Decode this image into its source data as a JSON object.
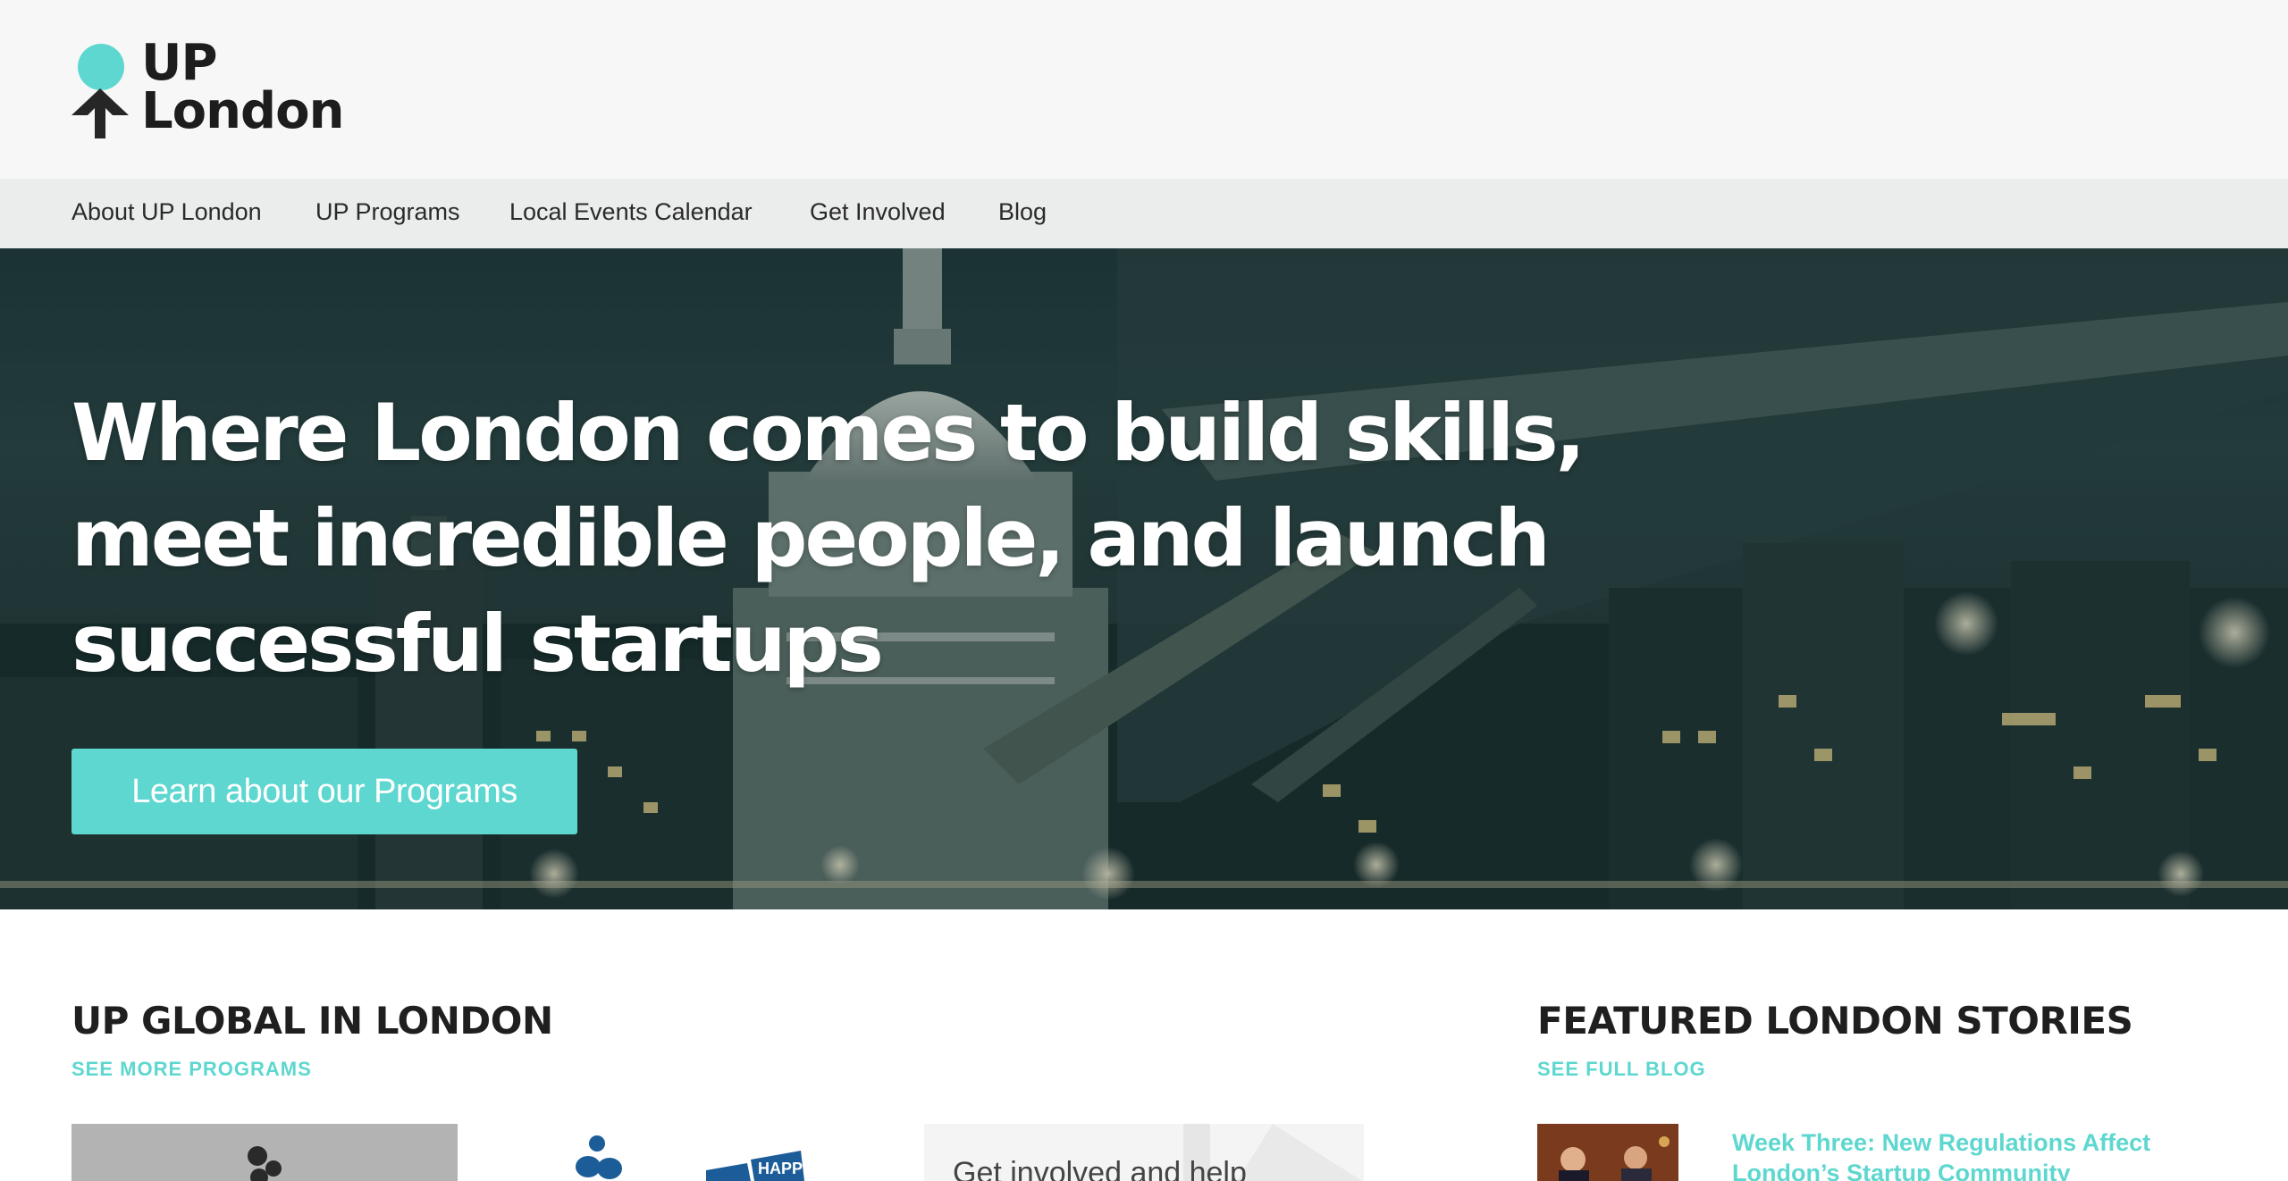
{
  "header": {
    "logo": {
      "line1": "UP",
      "line2": "London"
    }
  },
  "nav": {
    "items": [
      {
        "label": "About UP London"
      },
      {
        "label": "UP Programs"
      },
      {
        "label": "Local Events Calendar"
      },
      {
        "label": "Get Involved"
      },
      {
        "label": "Blog"
      }
    ]
  },
  "hero": {
    "title": "Where London comes to build skills, meet incredible people, and launch successful startups",
    "button_label": "Learn about our Programs"
  },
  "programs": {
    "title": "UP GLOBAL IN LONDON",
    "link": "SEE MORE PROGRAMS",
    "cards": [
      {
        "icon": "program-logo-icon"
      },
      {
        "icon": "make-it-happen-logo-icon",
        "label": "HAPPEN"
      },
      {
        "text": "Get involved and help"
      }
    ]
  },
  "stories": {
    "title": "FEATURED LONDON STORIES",
    "link": "SEE FULL BLOG",
    "items": [
      {
        "title": "Week Three: New Regulations Affect London’s Startup Community"
      }
    ]
  },
  "colors": {
    "accent": "#5dd7cf",
    "header_bg": "#f6f7f6",
    "nav_bg": "#ebedec",
    "text_dark": "#1f1f1f"
  }
}
